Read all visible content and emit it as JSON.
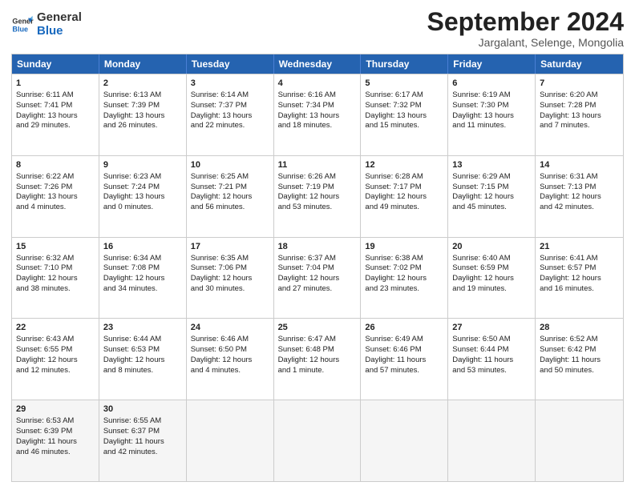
{
  "header": {
    "logo_line1": "General",
    "logo_line2": "Blue",
    "month_title": "September 2024",
    "location": "Jargalant, Selenge, Mongolia"
  },
  "days_of_week": [
    "Sunday",
    "Monday",
    "Tuesday",
    "Wednesday",
    "Thursday",
    "Friday",
    "Saturday"
  ],
  "weeks": [
    [
      {
        "day": "1",
        "lines": [
          "Sunrise: 6:11 AM",
          "Sunset: 7:41 PM",
          "Daylight: 13 hours",
          "and 29 minutes."
        ]
      },
      {
        "day": "2",
        "lines": [
          "Sunrise: 6:13 AM",
          "Sunset: 7:39 PM",
          "Daylight: 13 hours",
          "and 26 minutes."
        ]
      },
      {
        "day": "3",
        "lines": [
          "Sunrise: 6:14 AM",
          "Sunset: 7:37 PM",
          "Daylight: 13 hours",
          "and 22 minutes."
        ]
      },
      {
        "day": "4",
        "lines": [
          "Sunrise: 6:16 AM",
          "Sunset: 7:34 PM",
          "Daylight: 13 hours",
          "and 18 minutes."
        ]
      },
      {
        "day": "5",
        "lines": [
          "Sunrise: 6:17 AM",
          "Sunset: 7:32 PM",
          "Daylight: 13 hours",
          "and 15 minutes."
        ]
      },
      {
        "day": "6",
        "lines": [
          "Sunrise: 6:19 AM",
          "Sunset: 7:30 PM",
          "Daylight: 13 hours",
          "and 11 minutes."
        ]
      },
      {
        "day": "7",
        "lines": [
          "Sunrise: 6:20 AM",
          "Sunset: 7:28 PM",
          "Daylight: 13 hours",
          "and 7 minutes."
        ]
      }
    ],
    [
      {
        "day": "8",
        "lines": [
          "Sunrise: 6:22 AM",
          "Sunset: 7:26 PM",
          "Daylight: 13 hours",
          "and 4 minutes."
        ]
      },
      {
        "day": "9",
        "lines": [
          "Sunrise: 6:23 AM",
          "Sunset: 7:24 PM",
          "Daylight: 13 hours",
          "and 0 minutes."
        ]
      },
      {
        "day": "10",
        "lines": [
          "Sunrise: 6:25 AM",
          "Sunset: 7:21 PM",
          "Daylight: 12 hours",
          "and 56 minutes."
        ]
      },
      {
        "day": "11",
        "lines": [
          "Sunrise: 6:26 AM",
          "Sunset: 7:19 PM",
          "Daylight: 12 hours",
          "and 53 minutes."
        ]
      },
      {
        "day": "12",
        "lines": [
          "Sunrise: 6:28 AM",
          "Sunset: 7:17 PM",
          "Daylight: 12 hours",
          "and 49 minutes."
        ]
      },
      {
        "day": "13",
        "lines": [
          "Sunrise: 6:29 AM",
          "Sunset: 7:15 PM",
          "Daylight: 12 hours",
          "and 45 minutes."
        ]
      },
      {
        "day": "14",
        "lines": [
          "Sunrise: 6:31 AM",
          "Sunset: 7:13 PM",
          "Daylight: 12 hours",
          "and 42 minutes."
        ]
      }
    ],
    [
      {
        "day": "15",
        "lines": [
          "Sunrise: 6:32 AM",
          "Sunset: 7:10 PM",
          "Daylight: 12 hours",
          "and 38 minutes."
        ]
      },
      {
        "day": "16",
        "lines": [
          "Sunrise: 6:34 AM",
          "Sunset: 7:08 PM",
          "Daylight: 12 hours",
          "and 34 minutes."
        ]
      },
      {
        "day": "17",
        "lines": [
          "Sunrise: 6:35 AM",
          "Sunset: 7:06 PM",
          "Daylight: 12 hours",
          "and 30 minutes."
        ]
      },
      {
        "day": "18",
        "lines": [
          "Sunrise: 6:37 AM",
          "Sunset: 7:04 PM",
          "Daylight: 12 hours",
          "and 27 minutes."
        ]
      },
      {
        "day": "19",
        "lines": [
          "Sunrise: 6:38 AM",
          "Sunset: 7:02 PM",
          "Daylight: 12 hours",
          "and 23 minutes."
        ]
      },
      {
        "day": "20",
        "lines": [
          "Sunrise: 6:40 AM",
          "Sunset: 6:59 PM",
          "Daylight: 12 hours",
          "and 19 minutes."
        ]
      },
      {
        "day": "21",
        "lines": [
          "Sunrise: 6:41 AM",
          "Sunset: 6:57 PM",
          "Daylight: 12 hours",
          "and 16 minutes."
        ]
      }
    ],
    [
      {
        "day": "22",
        "lines": [
          "Sunrise: 6:43 AM",
          "Sunset: 6:55 PM",
          "Daylight: 12 hours",
          "and 12 minutes."
        ]
      },
      {
        "day": "23",
        "lines": [
          "Sunrise: 6:44 AM",
          "Sunset: 6:53 PM",
          "Daylight: 12 hours",
          "and 8 minutes."
        ]
      },
      {
        "day": "24",
        "lines": [
          "Sunrise: 6:46 AM",
          "Sunset: 6:50 PM",
          "Daylight: 12 hours",
          "and 4 minutes."
        ]
      },
      {
        "day": "25",
        "lines": [
          "Sunrise: 6:47 AM",
          "Sunset: 6:48 PM",
          "Daylight: 12 hours",
          "and 1 minute."
        ]
      },
      {
        "day": "26",
        "lines": [
          "Sunrise: 6:49 AM",
          "Sunset: 6:46 PM",
          "Daylight: 11 hours",
          "and 57 minutes."
        ]
      },
      {
        "day": "27",
        "lines": [
          "Sunrise: 6:50 AM",
          "Sunset: 6:44 PM",
          "Daylight: 11 hours",
          "and 53 minutes."
        ]
      },
      {
        "day": "28",
        "lines": [
          "Sunrise: 6:52 AM",
          "Sunset: 6:42 PM",
          "Daylight: 11 hours",
          "and 50 minutes."
        ]
      }
    ],
    [
      {
        "day": "29",
        "lines": [
          "Sunrise: 6:53 AM",
          "Sunset: 6:39 PM",
          "Daylight: 11 hours",
          "and 46 minutes."
        ]
      },
      {
        "day": "30",
        "lines": [
          "Sunrise: 6:55 AM",
          "Sunset: 6:37 PM",
          "Daylight: 11 hours",
          "and 42 minutes."
        ]
      },
      {
        "day": "",
        "lines": []
      },
      {
        "day": "",
        "lines": []
      },
      {
        "day": "",
        "lines": []
      },
      {
        "day": "",
        "lines": []
      },
      {
        "day": "",
        "lines": []
      }
    ]
  ]
}
